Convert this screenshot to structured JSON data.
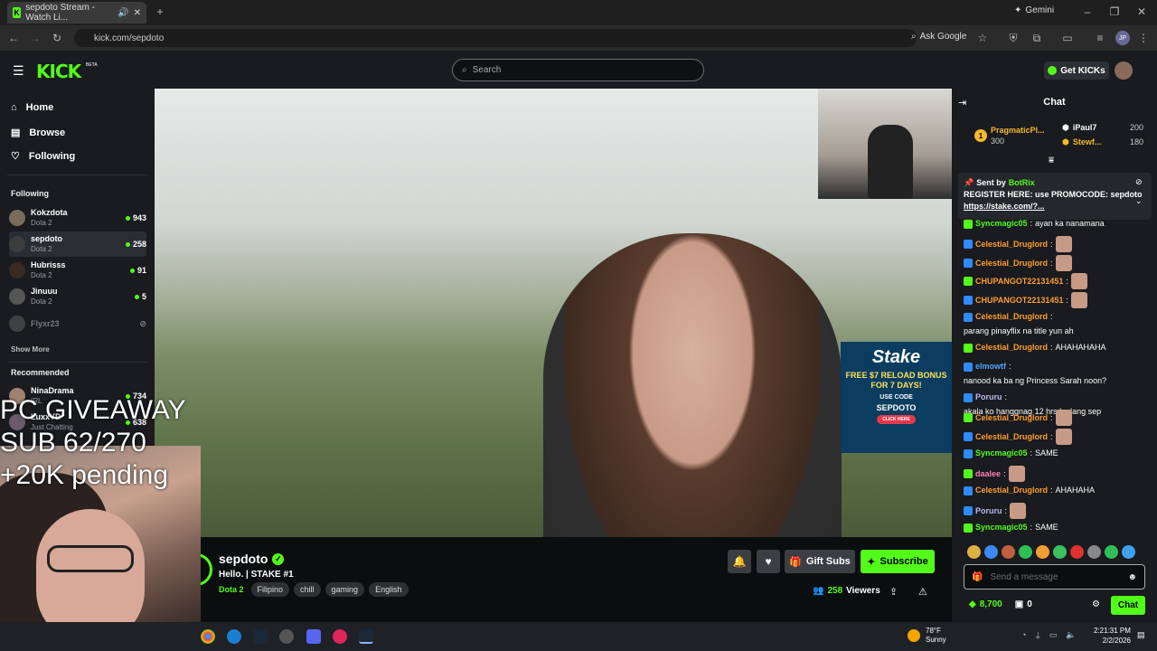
{
  "browser": {
    "tab_title": "sepdoto Stream - Watch Li...",
    "url": "kick.com/sepdoto",
    "gemini_label": "Gemini",
    "ask_google_label": "Ask Google",
    "profile_initials": "JP"
  },
  "header": {
    "logo": "KICK",
    "beta": "BETA",
    "search_placeholder": "Search",
    "get_kicks_label": "Get KICKs"
  },
  "sidebar": {
    "nav": [
      {
        "label": "Home",
        "icon": "home-icon"
      },
      {
        "label": "Browse",
        "icon": "browse-icon"
      },
      {
        "label": "Following",
        "icon": "heart-icon"
      }
    ],
    "following_heading": "Following",
    "following": [
      {
        "name": "Kokzdota",
        "game": "Dota 2",
        "viewers": "943"
      },
      {
        "name": "sepdoto",
        "game": "Dota 2",
        "viewers": "258"
      },
      {
        "name": "Hubrisss",
        "game": "Dota 2",
        "viewers": "91"
      },
      {
        "name": "Jinuuu",
        "game": "Dota 2",
        "viewers": "5"
      },
      {
        "name": "Flyxr23",
        "game": "",
        "viewers": ""
      }
    ],
    "show_more": "Show More",
    "recommended_heading": "Recommended",
    "recommended": [
      {
        "name": "NinaDrama",
        "game": "IRL",
        "viewers": "734"
      },
      {
        "name": "LuxxYD",
        "game": "Just Chatting",
        "viewers": "638"
      }
    ]
  },
  "overlay": {
    "giveaway_lines": [
      "PC GIVEAWAY",
      "SUB 62/270",
      "+20K pending"
    ]
  },
  "stake_ad": {
    "brand": "Stake",
    "promo": "FREE $7 RELOAD BONUS FOR 7 DAYS!",
    "use_code": "USE CODE",
    "code": "SEPDOTO",
    "cta": "CLICK HERE"
  },
  "stream": {
    "channel": "sepdoto",
    "title": "Hello. | STAKE #1",
    "category": "Dota 2",
    "tags": [
      "Filipino",
      "chill",
      "gaming",
      "English"
    ],
    "gift_label": "Gift Subs",
    "subscribe_label": "Subscribe",
    "viewers": "258",
    "viewers_label": "Viewers"
  },
  "chat": {
    "title": "Chat",
    "leaderboard": [
      {
        "rank": "1",
        "name": "PragmaticPl...",
        "amount": "300"
      },
      {
        "name": "iPaul7",
        "amount": "200"
      },
      {
        "name": "Stewf...",
        "amount": "180"
      }
    ],
    "pinned": {
      "sent_by": "Sent by",
      "bot": "BotRix",
      "text": "REGISTER HERE: use PROMOCODE: sepdoto",
      "link": "https://stake.com/?..."
    },
    "messages": [
      {
        "user": "Syncmagic05",
        "text": "ayan ka nanamana",
        "color": "#53fc18"
      },
      {
        "user": "Celestial_Druglord",
        "text": "",
        "color": "#ff9d2e",
        "emote": true
      },
      {
        "user": "Celestial_Druglord",
        "text": "",
        "color": "#ff9d2e",
        "emote": true
      },
      {
        "user": "CHUPANGOT22131451",
        "text": "",
        "color": "#ff9d2e",
        "emote": true
      },
      {
        "user": "CHUPANGOT22131451",
        "text": "",
        "color": "#ff9d2e",
        "emote": true
      },
      {
        "user": "Celestial_Druglord",
        "text": "parang pinayflix na title yun ah",
        "color": "#ff9d2e"
      },
      {
        "user": "Celestial_Druglord",
        "text": "AHAHAHAHA",
        "color": "#ff9d2e"
      },
      {
        "user": "elmowtf",
        "text": "nanood ka ba ng Princess Sarah noon?",
        "color": "#4fa3ff"
      },
      {
        "user": "Poruru",
        "text": "akala ko hanggnag 12 hrs ka lang sep",
        "color": "#b9bbf5"
      },
      {
        "user": "Celestial_Druglord",
        "text": "",
        "color": "#ff9d2e",
        "emote": true
      },
      {
        "user": "Celestial_Druglord",
        "text": "",
        "color": "#ff9d2e",
        "emote": true
      },
      {
        "user": "Syncmagic05",
        "text": "SAME",
        "color": "#53fc18"
      },
      {
        "user": "daalee",
        "text": "",
        "color": "#ff7eb0",
        "emote": true
      },
      {
        "user": "Celestial_Druglord",
        "text": "AHAHAHA",
        "color": "#ff9d2e"
      },
      {
        "user": "Poruru",
        "text": "",
        "color": "#b9bbf5",
        "emote": true
      },
      {
        "user": "Syncmagic05",
        "text": "SAME",
        "color": "#53fc18"
      }
    ],
    "input_placeholder": "Send a message",
    "points": "8,700",
    "gift_count": "0",
    "chat_button": "Chat"
  },
  "taskbar": {
    "temp": "78°F",
    "weather": "Sunny",
    "time": "2:21:31 PM",
    "date": "2/2/2026"
  },
  "colors": {
    "accent": "#53fc18",
    "panel": "#191b1f",
    "background": "#0b0e0f"
  }
}
